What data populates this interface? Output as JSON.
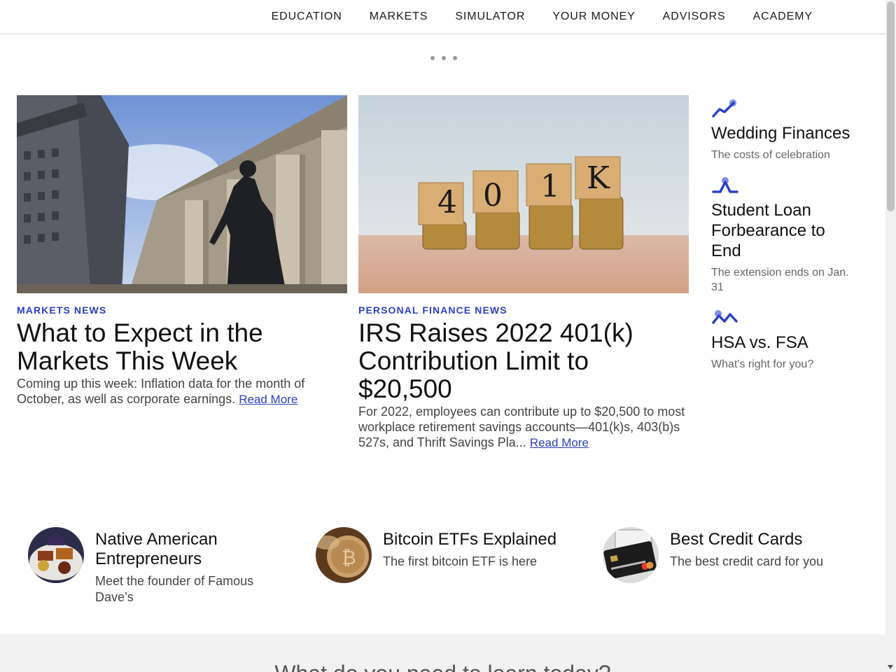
{
  "nav": {
    "items": [
      "EDUCATION",
      "MARKETS",
      "SIMULATOR",
      "YOUR MONEY",
      "ADVISORS",
      "ACADEMY"
    ]
  },
  "features": [
    {
      "tag": "MARKETS NEWS",
      "title": "What to Expect in the Markets This Week",
      "summary": "Coming up this week: Inflation data for the month of October, as well as corporate earnings.",
      "link": "Read More"
    },
    {
      "tag": "PERSONAL FINANCE NEWS",
      "title": "IRS Raises 2022 401(k) Contribution Limit to $20,500",
      "summary": "For 2022, employees can contribute up to $20,500 to most workplace retirement savings accounts—401(k)s, 403(b)s 527s, and Thrift Savings Pla...",
      "link": "Read More",
      "image_letters": [
        "4",
        "0",
        "1",
        "K"
      ]
    }
  ],
  "rail": [
    {
      "icon": "trend-up-icon",
      "title": "Wedding Finances",
      "subtitle": "The costs of celebration"
    },
    {
      "icon": "peak-icon",
      "title": "Student Loan Forbearance to End",
      "subtitle": "The extension ends on Jan. 31"
    },
    {
      "icon": "zigzag-icon",
      "title": "HSA vs. FSA",
      "subtitle": "What's right for you?"
    }
  ],
  "promos": [
    {
      "title": "Native American Entrepreneurs",
      "subtitle": "Meet the founder of Famous Dave’s"
    },
    {
      "title": "Bitcoin ETFs Explained",
      "subtitle": "The first bitcoin ETF is here"
    },
    {
      "title": "Best Credit Cards",
      "subtitle": "The best credit card for you"
    }
  ],
  "band": {
    "heading": "What do you need to learn today?"
  },
  "colors": {
    "accent": "#2c40c7",
    "icon_dot": "#7f8fe8",
    "band_bg": "#f2f2f2"
  }
}
